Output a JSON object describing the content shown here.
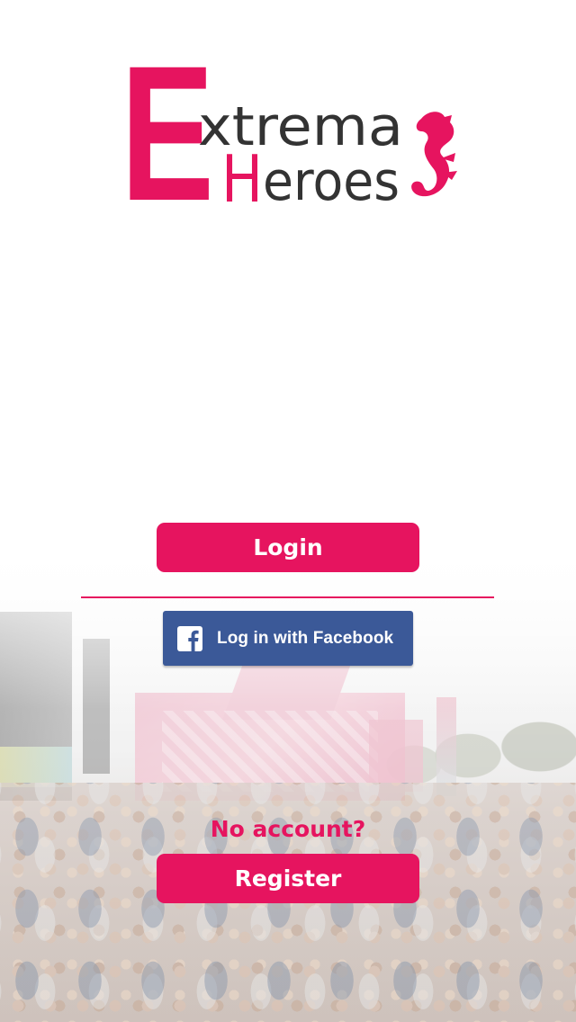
{
  "app": {
    "logo_big_letter": "E",
    "logo_word1": "xtrema",
    "logo_word2_initial": "H",
    "logo_word2_rest": "eroes"
  },
  "login": {
    "button_label": "Login"
  },
  "facebook": {
    "button_label": "Log in with Facebook",
    "icon": "facebook-icon"
  },
  "register": {
    "prompt": "No account?",
    "button_label": "Register"
  },
  "colors": {
    "accent": "#e6145f",
    "facebook_blue": "#3b5998",
    "logo_dark": "#333333",
    "background": "#ffffff"
  }
}
